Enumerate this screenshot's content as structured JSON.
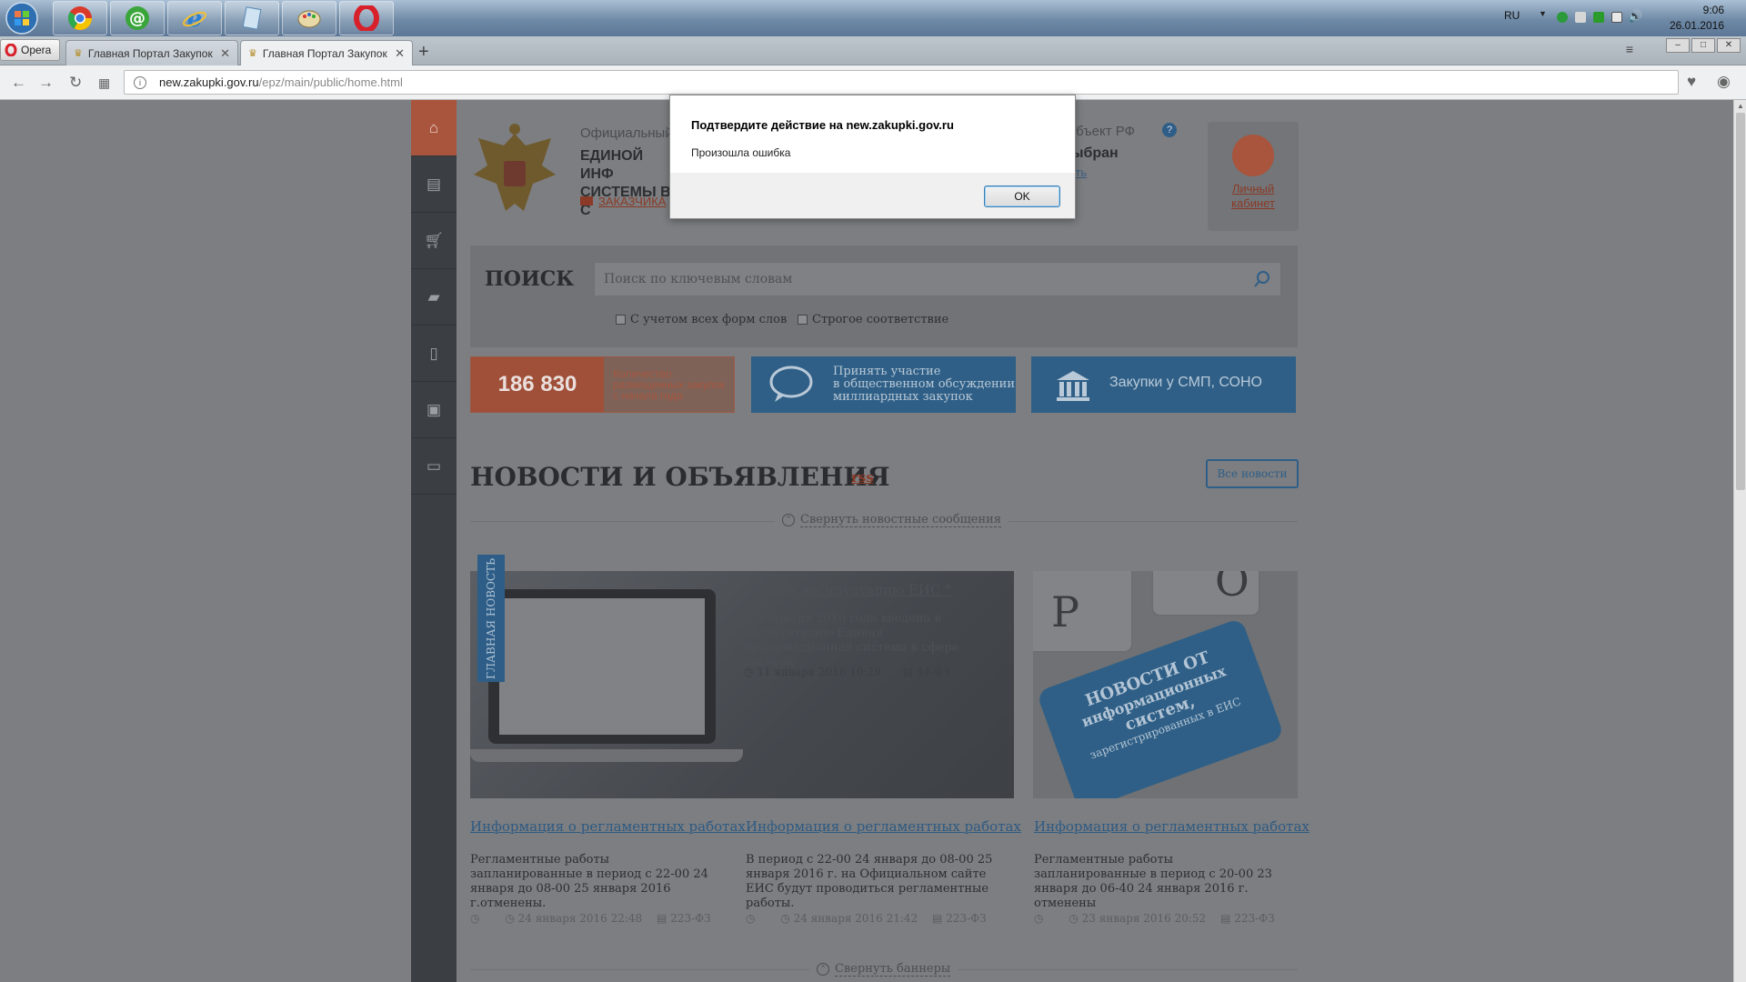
{
  "taskbar": {
    "apps": [
      {
        "name": "start-button",
        "color": "#2e7ac4"
      },
      {
        "name": "chrome",
        "color": "#d44"
      },
      {
        "name": "mail-agent",
        "color": "#3aa53a"
      },
      {
        "name": "internet-explorer",
        "color": "#2b7fd4"
      },
      {
        "name": "notepad",
        "color": "#9fbfdb"
      },
      {
        "name": "paint",
        "color": "#d9c079"
      },
      {
        "name": "opera",
        "color": "#d8202a"
      }
    ],
    "lang": "RU",
    "time": "9:06",
    "date": "26.01.2016"
  },
  "browser": {
    "menu_label": "Opera",
    "tabs": [
      {
        "label": "Главная Портал Закупок"
      },
      {
        "label": "Главная Портал Закупок"
      }
    ],
    "url_prefix": "new.zakupki.gov.ru",
    "url_path": "/epz/main/public/home.html"
  },
  "dialog": {
    "title": "Подтвердите действие на new.zakupki.gov.ru",
    "message": "Произошла ошибка",
    "ok_label": "OK"
  },
  "sidebar": {
    "items": [
      "home-icon",
      "calendar-icon",
      "cart-icon",
      "book-icon",
      "document-icon",
      "briefcase-icon",
      "notes-icon"
    ]
  },
  "header": {
    "official": "Официальный",
    "system_line1": "ЕДИНОЙ ИНФ",
    "system_line2": "СИСТЕМЫ В С",
    "customers_link": "ЗАКАЗЧИКА",
    "subject_label": "субъект РФ",
    "subject_value": "выбран",
    "subject_change": "нить",
    "cabinet_line1": "Личный",
    "cabinet_line2": "кабинет"
  },
  "search": {
    "title": "ПОИСК",
    "placeholder": "Поиск по ключевым словам",
    "option1": "С учетом всех форм слов",
    "option2": "Строгое соответствие"
  },
  "stats": {
    "count": "186 830",
    "text_line1": "Количество",
    "text_line2": "размещенных закупок",
    "text_line3": "с начала года"
  },
  "discussion": {
    "line1": "Принять участие",
    "line2": "в общественном обсуждении",
    "line3": "миллиардных закупок"
  },
  "smp": {
    "label": "Закупки у СМП, СОНО"
  },
  "news": {
    "title": "НОВОСТИ И ОБЪЯВЛЕНИЯ",
    "rss": "rss",
    "all_news": "Все новости",
    "collapse_news": "Свернуть новостные сообщения",
    "collapse_banners": "Свернуть баннеры",
    "main_badge": "ГЛАВНАЯ НОВОСТЬ",
    "main": {
      "title": "\"Ввод в эксплуатацию ЕИС \"",
      "text": "С 1 января 2016 года введена в эксплуатацию Единая информационная система в сфере закупок",
      "date": "11 января 2016 10:29",
      "law": "44-ФЗ"
    },
    "banner": {
      "line1": "НОВОСТИ ОТ",
      "line2": "информационных",
      "line3": "систем,",
      "line4": "зарегистрированных в ЕИС"
    },
    "cards": [
      {
        "title": "Информация о регламентных работах",
        "text": "Регламентные работы запланированные в период с 22-00 24 января до 08-00 25 января 2016 г.отменены.",
        "date": "24 января 2016 22:48",
        "law": "223-ФЗ"
      },
      {
        "title": "Информация о регламентных работах",
        "text": "В период с 22-00 24 января до 08-00 25 января 2016 г. на Официальном сайте ЕИС будут проводиться регламентные работы.",
        "date": "24 января 2016 21:42",
        "law": "223-ФЗ"
      },
      {
        "title": "Информация о регламентных работах",
        "text": "Регламентные работы запланированные в период с 20-00 23 января до 06-40 24 января 2016 г. отменены",
        "date": "23 января 2016 20:52",
        "law": "223-ФЗ"
      }
    ]
  }
}
